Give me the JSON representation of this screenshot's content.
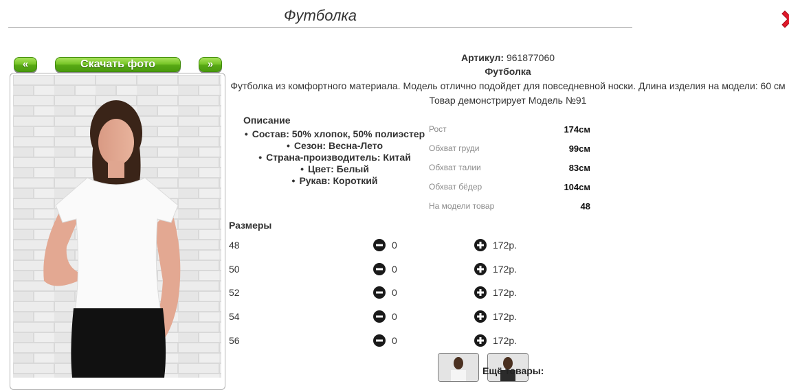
{
  "page": {
    "title": "Футболка"
  },
  "photo_nav": {
    "prev_label": "«",
    "download_label": "Скачать фото",
    "next_label": "»"
  },
  "product": {
    "sku_label": "Артикул:",
    "sku_value": "961877060",
    "name": "Футболка",
    "description": "Футболка из комфортного материала. Модель отлично подойдет для повседневной носки. Длина изделия на модели: 60 см",
    "model_note": "Товар демонстрирует Модель №91"
  },
  "details": {
    "title": "Описание",
    "features": [
      "Состав: 50% хлопок, 50% полиэстер",
      "Сезон: Весна-Лето",
      "Страна-производитель: Китай",
      "Цвет: Белый",
      "Рукав: Короткий"
    ]
  },
  "measurements": [
    {
      "label": "Рост",
      "value": "174см"
    },
    {
      "label": "Обхват груди",
      "value": "99см"
    },
    {
      "label": "Обхват талии",
      "value": "83см"
    },
    {
      "label": "Обхват бёдер",
      "value": "104см"
    },
    {
      "label": "На модели товар",
      "value": "48"
    }
  ],
  "sizes": {
    "title": "Размеры",
    "rows": [
      {
        "size": "48",
        "qty": "0",
        "price": "172р."
      },
      {
        "size": "50",
        "qty": "0",
        "price": "172р."
      },
      {
        "size": "52",
        "qty": "0",
        "price": "172р."
      },
      {
        "size": "54",
        "qty": "0",
        "price": "172р."
      },
      {
        "size": "56",
        "qty": "0",
        "price": "172р."
      }
    ]
  },
  "more": {
    "label": "Ещё товары:"
  },
  "colors": {
    "button_green": "#5cb01a",
    "close_red": "#e0182a",
    "text": "#333333",
    "label_grey": "#8a8a8a"
  },
  "icons": {
    "close": "close-x-icon",
    "minus": "minus-circle-icon",
    "plus": "plus-circle-icon"
  }
}
